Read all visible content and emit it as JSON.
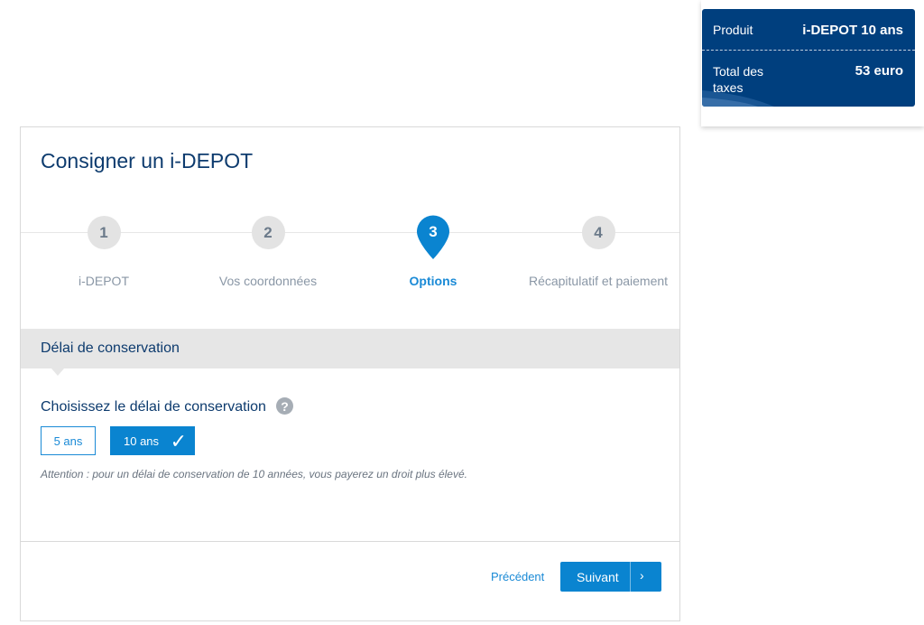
{
  "summary": {
    "product_label": "Produit",
    "product_value": "i-DEPOT 10 ans",
    "total_label": "Total des taxes",
    "total_value": "53 euro"
  },
  "card": {
    "title": "Consigner un i-DEPOT"
  },
  "steps": [
    {
      "number": "1",
      "label": "i-DEPOT",
      "active": false
    },
    {
      "number": "2",
      "label": "Vos coordonnées",
      "active": false
    },
    {
      "number": "3",
      "label": "Options",
      "active": true
    },
    {
      "number": "4",
      "label": "Récapitulatif et paiement",
      "active": false
    }
  ],
  "section": {
    "title": "Délai de conservation",
    "question": "Choisissez le délai de conservation",
    "help_icon": "question-circle-icon",
    "options": [
      {
        "label": "5 ans",
        "selected": false
      },
      {
        "label": "10 ans",
        "selected": true
      }
    ],
    "attention": "Attention : pour un délai de conservation de 10 années, vous payerez un droit plus élevé."
  },
  "footer": {
    "prev_label": "Précédent",
    "next_label": "Suivant"
  },
  "colors": {
    "brand_dark": "#003f7e",
    "accent": "#0a84d0",
    "title_text": "#0d3b6e"
  }
}
